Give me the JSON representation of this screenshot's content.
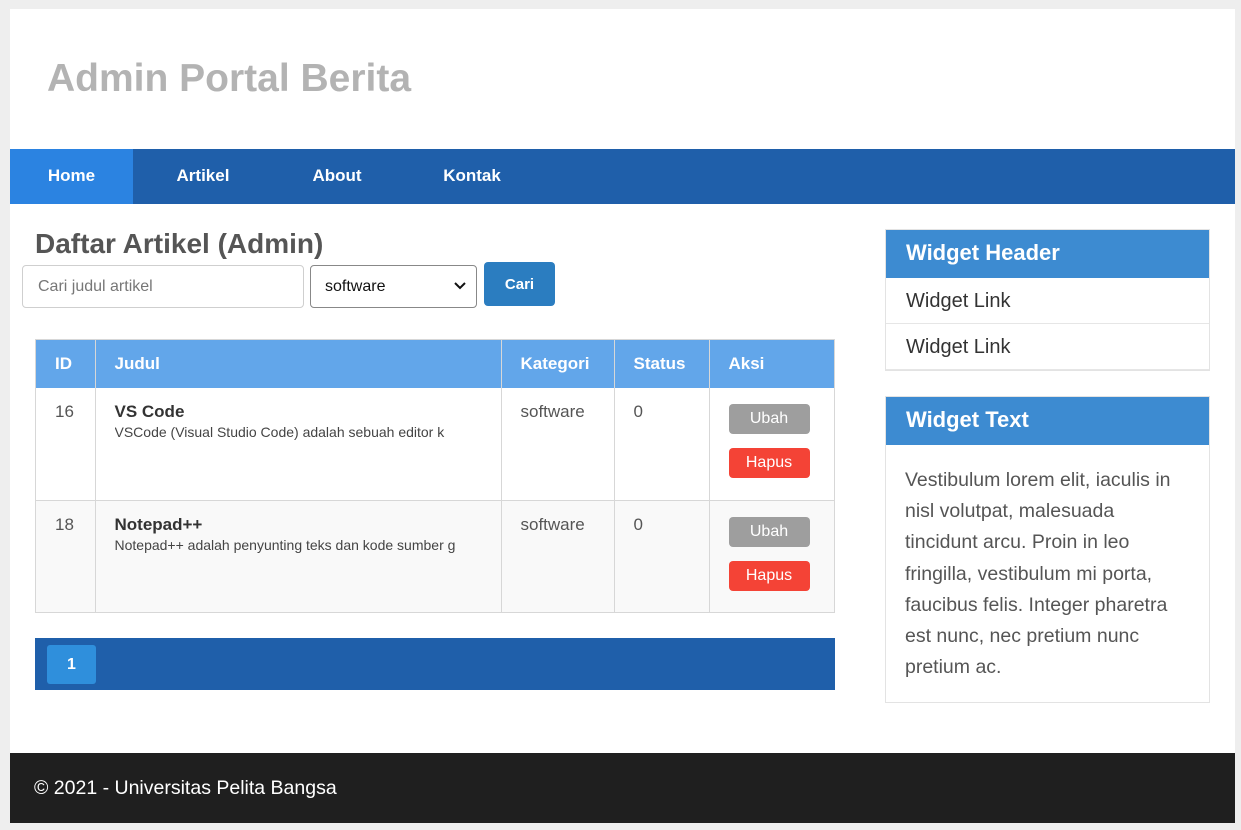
{
  "header": {
    "title": "Admin Portal Berita"
  },
  "nav": {
    "items": [
      "Home",
      "Artikel",
      "About",
      "Kontak"
    ]
  },
  "main": {
    "title": "Daftar Artikel (Admin)",
    "search": {
      "placeholder": "Cari judul artikel",
      "value": ""
    },
    "category": {
      "selected": "software"
    },
    "search_button": "Cari",
    "table": {
      "headers": [
        "ID",
        "Judul",
        "Kategori",
        "Status",
        "Aksi"
      ],
      "rows": [
        {
          "id": "16",
          "title": "VS Code",
          "desc": "VSCode (Visual Studio Code) adalah sebuah editor k",
          "kategori": "software",
          "status": "0",
          "ubah": "Ubah",
          "hapus": "Hapus"
        },
        {
          "id": "18",
          "title": "Notepad++",
          "desc": "Notepad++ adalah penyunting teks dan kode sumber g",
          "kategori": "software",
          "status": "0",
          "ubah": "Ubah",
          "hapus": "Hapus"
        }
      ]
    },
    "pagination": {
      "current": "1"
    }
  },
  "sidebar": {
    "widget1": {
      "header": "Widget Header",
      "links": [
        "Widget Link",
        "Widget Link"
      ]
    },
    "widget2": {
      "header": "Widget Text",
      "text": "Vestibulum lorem elit, iaculis in nisl volutpat, malesuada tincidunt arcu. Proin in leo fringilla, vestibulum mi porta, faucibus felis. Integer pharetra est nunc, nec pretium nunc pretium ac."
    }
  },
  "footer": {
    "text": "© 2021 - Universitas Pelita Bangsa"
  },
  "colors": {
    "nav": "#1f5faa",
    "nav_active": "#2b83e1",
    "table_header": "#62a6ea",
    "widget_header": "#3d8bd1",
    "danger": "#f44336",
    "footer": "#1f1f1f"
  }
}
